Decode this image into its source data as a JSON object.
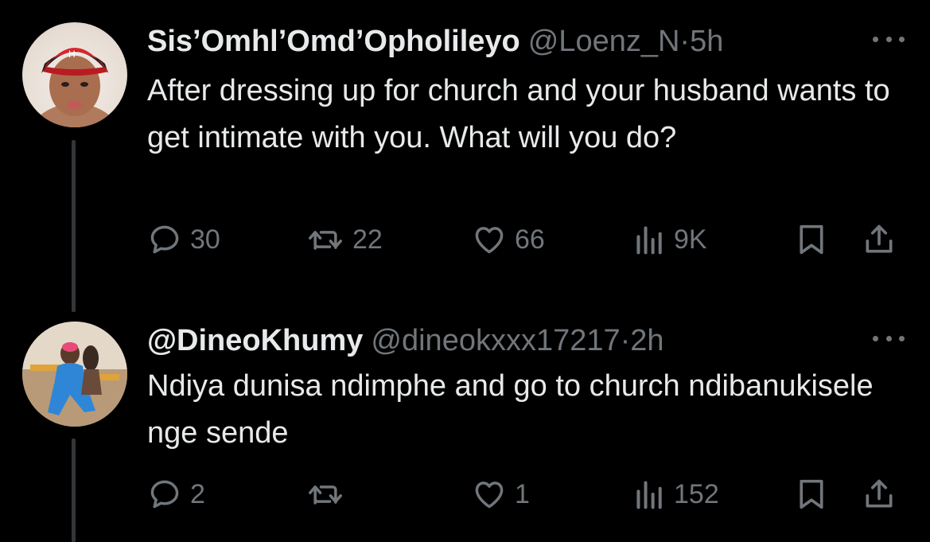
{
  "tweets": [
    {
      "display_name": "Sis’Omhl’Omd’Opholileyo",
      "handle": "@Loenz_N",
      "separator": "·",
      "time": "5h",
      "text": "After dressing up for church and your husband wants to get intimate with you. What will you do?",
      "replies": "30",
      "retweets": "22",
      "likes": "66",
      "views": "9K",
      "avatar": "avatar-woman-red-cap"
    },
    {
      "display_name": "@DineoKhumy",
      "handle": "@dineokxxx17217",
      "separator": "·",
      "time": "2h",
      "text": "Ndiya dunisa ndimphe and go to church ndibanukisele nge sende",
      "replies": "2",
      "retweets": "",
      "likes": "1",
      "views": "152",
      "avatar": "avatar-woman-blue-outfit"
    }
  ],
  "icons": {
    "more": "more-horizontal-icon",
    "reply": "reply-bubble-icon",
    "retweet": "retweet-arrows-icon",
    "like": "heart-icon",
    "views": "bar-chart-icon",
    "bookmark": "bookmark-icon",
    "share": "share-upload-icon"
  },
  "colors": {
    "background": "#000000",
    "primary_text": "#e7e9ea",
    "secondary_text": "#71767b",
    "thread_line": "#333639"
  }
}
